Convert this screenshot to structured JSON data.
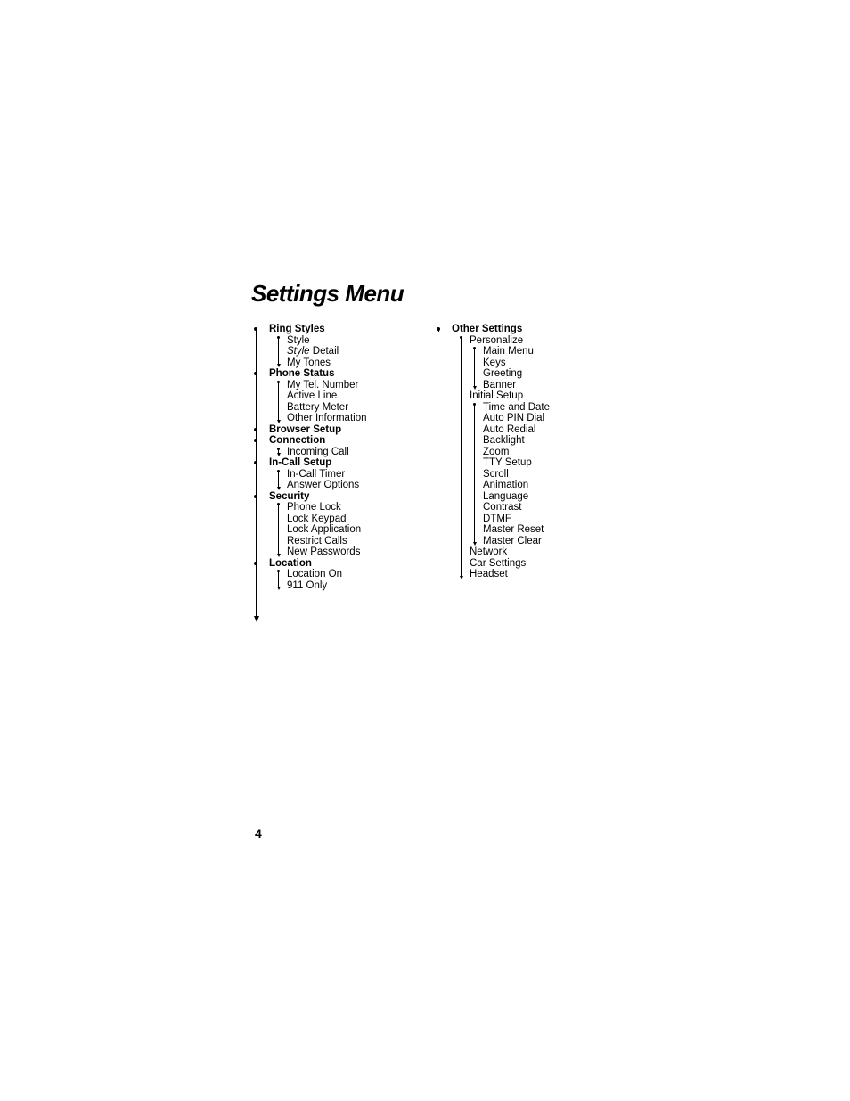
{
  "title": "Settings Menu",
  "page_number": "4",
  "left_column": [
    {
      "label": "Ring Styles",
      "level": 0,
      "bold": true
    },
    {
      "label": "Style",
      "level": 1
    },
    {
      "label_prefix_italic": "Style",
      "label_suffix": " Detail",
      "level": 1
    },
    {
      "label": "My Tones",
      "level": 1
    },
    {
      "label": "Phone Status",
      "level": 0,
      "bold": true
    },
    {
      "label": "My Tel. Number",
      "level": 1
    },
    {
      "label": "Active Line",
      "level": 1
    },
    {
      "label": "Battery Meter",
      "level": 1
    },
    {
      "label": "Other Information",
      "level": 1
    },
    {
      "label": "Browser Setup",
      "level": 0,
      "bold": true
    },
    {
      "label": "Connection",
      "level": 0,
      "bold": true
    },
    {
      "label": "Incoming Call",
      "level": 1
    },
    {
      "label": "In-Call Setup",
      "level": 0,
      "bold": true
    },
    {
      "label": "In-Call Timer",
      "level": 1
    },
    {
      "label": "Answer Options",
      "level": 1
    },
    {
      "label": "Security",
      "level": 0,
      "bold": true
    },
    {
      "label": "Phone Lock",
      "level": 1
    },
    {
      "label": "Lock Keypad",
      "level": 1
    },
    {
      "label": "Lock Application",
      "level": 1
    },
    {
      "label": "Restrict Calls",
      "level": 1
    },
    {
      "label": "New Passwords",
      "level": 1
    },
    {
      "label": "Location",
      "level": 0,
      "bold": true
    },
    {
      "label": "Location On",
      "level": 1
    },
    {
      "label": "911 Only",
      "level": 1
    }
  ],
  "right_column": [
    {
      "label": "Other Settings",
      "level": 0,
      "bold": true
    },
    {
      "label": "Personalize",
      "level": 1
    },
    {
      "label": "Main Menu",
      "level": 2
    },
    {
      "label": "Keys",
      "level": 2
    },
    {
      "label": "Greeting",
      "level": 2
    },
    {
      "label": "Banner",
      "level": 2
    },
    {
      "label": "Initial Setup",
      "level": 1
    },
    {
      "label": "Time and Date",
      "level": 2
    },
    {
      "label": "Auto PIN Dial",
      "level": 2
    },
    {
      "label": "Auto Redial",
      "level": 2
    },
    {
      "label": "Backlight",
      "level": 2
    },
    {
      "label": "Zoom",
      "level": 2
    },
    {
      "label": "TTY Setup",
      "level": 2
    },
    {
      "label": "Scroll",
      "level": 2
    },
    {
      "label": "Animation",
      "level": 2
    },
    {
      "label": "Language",
      "level": 2
    },
    {
      "label": "Contrast",
      "level": 2
    },
    {
      "label": "DTMF",
      "level": 2
    },
    {
      "label": "Master Reset",
      "level": 2
    },
    {
      "label": "Master Clear",
      "level": 2
    },
    {
      "label": "Network",
      "level": 1
    },
    {
      "label": "Car Settings",
      "level": 1
    },
    {
      "label": "Headset",
      "level": 1
    }
  ]
}
